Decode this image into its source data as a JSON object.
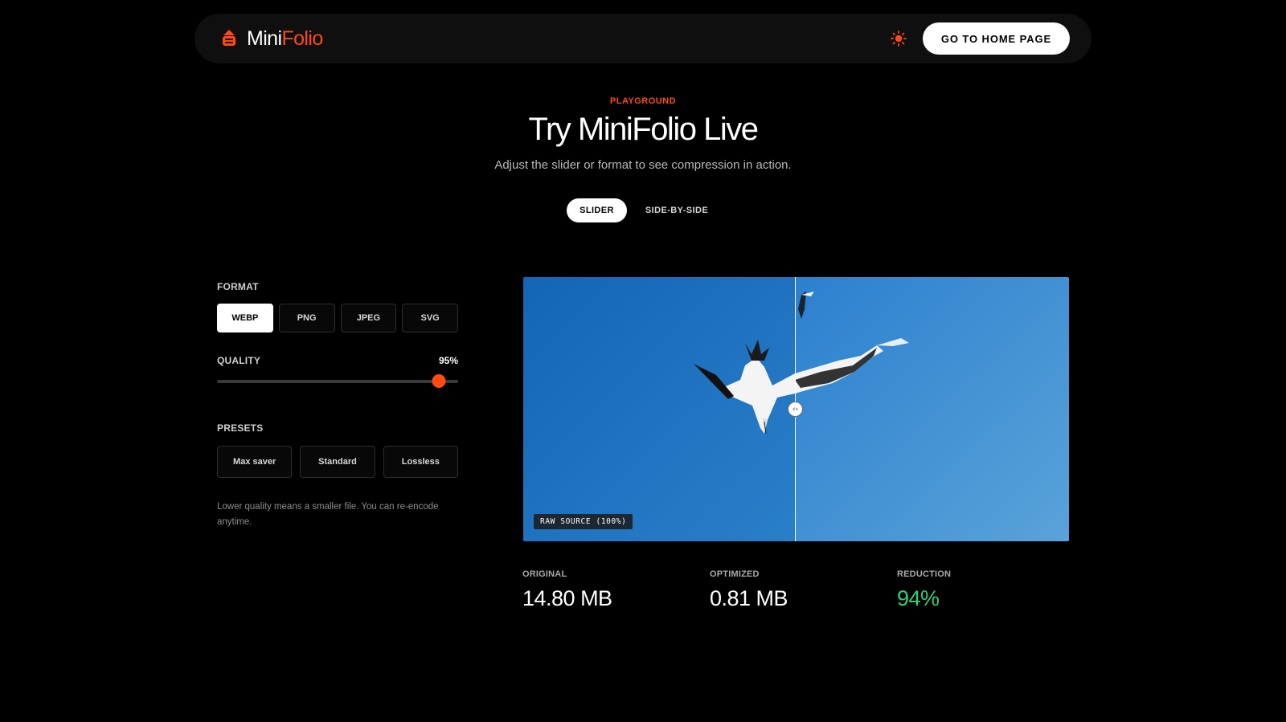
{
  "nav": {
    "logo_part1": "Mini",
    "logo_part2": "Folio",
    "home_button": "GO TO HOME PAGE"
  },
  "hero": {
    "eyebrow": "PLAYGROUND",
    "title": "Try MiniFolio Live",
    "subtitle": "Adjust the slider or format to see compression in action."
  },
  "view_toggle": {
    "slider": "SLIDER",
    "side_by_side": "SIDE-BY-SIDE",
    "selected": "SLIDER"
  },
  "controls": {
    "format_label": "FORMAT",
    "formats": [
      "WEBP",
      "PNG",
      "JPEG",
      "SVG"
    ],
    "selected_format": "WEBP",
    "quality_label": "QUALITY",
    "quality_value": "95%",
    "quality_fraction": 0.92,
    "presets_label": "PRESETS",
    "presets": [
      "Max saver",
      "Standard",
      "Lossless"
    ],
    "hint": "Lower quality means a smaller file. You can re-encode anytime."
  },
  "compare": {
    "badge": "RAW SOURCE (100%)",
    "divider_fraction": 0.5,
    "handle_icon": "‹›"
  },
  "stats": {
    "original_label": "ORIGINAL",
    "original_value": "14.80 MB",
    "optimized_label": "OPTIMIZED",
    "optimized_value": "0.81 MB",
    "reduction_label": "REDUCTION",
    "reduction_value": "94%"
  },
  "icons": {
    "logo": "logo-icon",
    "theme": "sun-icon",
    "handle": "split-handle-icon"
  },
  "colors": {
    "accent": "#ff4a14",
    "success": "#2bd27a",
    "background": "#000000"
  }
}
